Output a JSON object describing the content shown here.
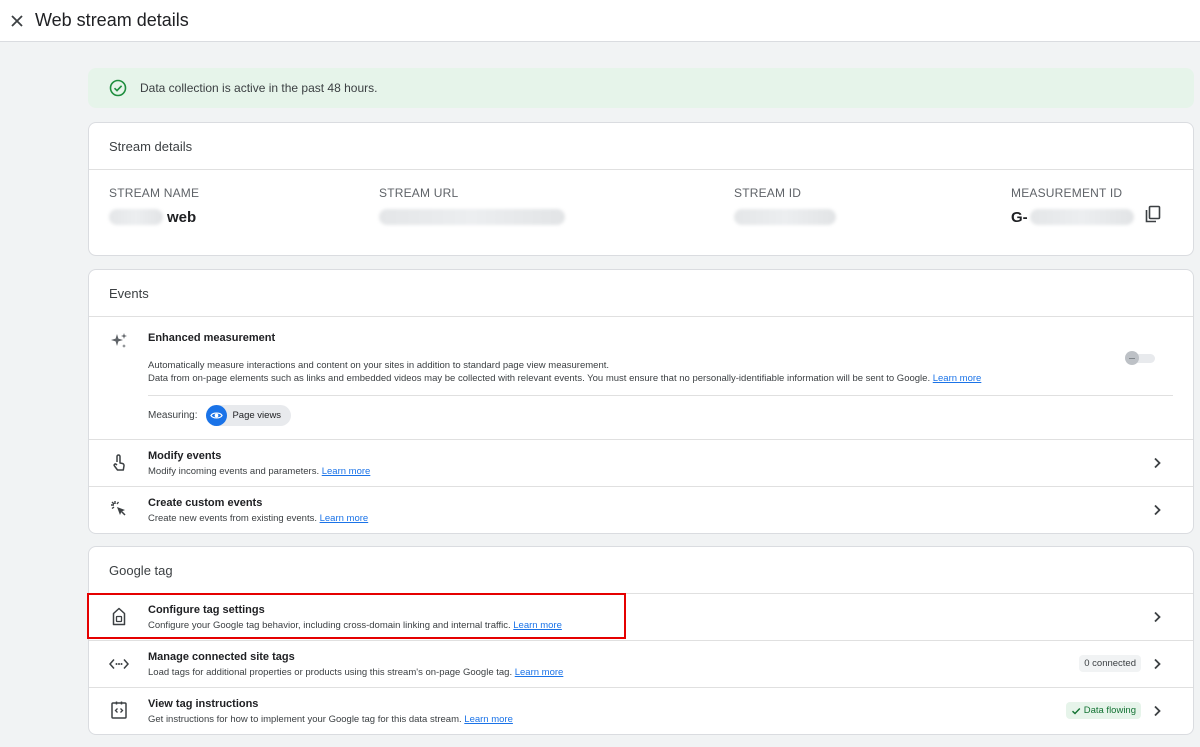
{
  "header": {
    "title": "Web stream details"
  },
  "banner": {
    "text": "Data collection is active in the past 48 hours."
  },
  "stream_details": {
    "title": "Stream details",
    "name_label": "STREAM NAME",
    "name_suffix": "web",
    "url_label": "STREAM URL",
    "id_label": "STREAM ID",
    "measurement_label": "MEASUREMENT ID",
    "measurement_prefix": "G-"
  },
  "events": {
    "title": "Events",
    "enhanced": {
      "title": "Enhanced measurement",
      "desc1": "Automatically measure interactions and content on your sites in addition to standard page view measurement.",
      "desc2": "Data from on-page elements such as links and embedded videos may be collected with relevant events. You must ensure that no personally-identifiable information will be sent to Google.",
      "link": "Learn more",
      "measuring_label": "Measuring:",
      "chip": "Page views"
    },
    "modify": {
      "title": "Modify events",
      "desc": "Modify incoming events and parameters.",
      "link": "Learn more"
    },
    "custom": {
      "title": "Create custom events",
      "desc": "Create new events from existing events.",
      "link": "Learn more"
    }
  },
  "google_tag": {
    "title": "Google tag",
    "configure": {
      "title": "Configure tag settings",
      "desc": "Configure your Google tag behavior, including cross-domain linking and internal traffic.",
      "link": "Learn more"
    },
    "manage": {
      "title": "Manage connected site tags",
      "desc": "Load tags for additional properties or products using this stream's on-page Google tag.",
      "link": "Learn more",
      "badge": "0 connected"
    },
    "instructions": {
      "title": "View tag instructions",
      "desc": "Get instructions for how to implement your Google tag for this data stream.",
      "link": "Learn more",
      "badge": "Data flowing"
    }
  },
  "colors": {
    "accent": "#1a73e8",
    "success": "#1e8e3e",
    "highlight": "#e50000"
  }
}
